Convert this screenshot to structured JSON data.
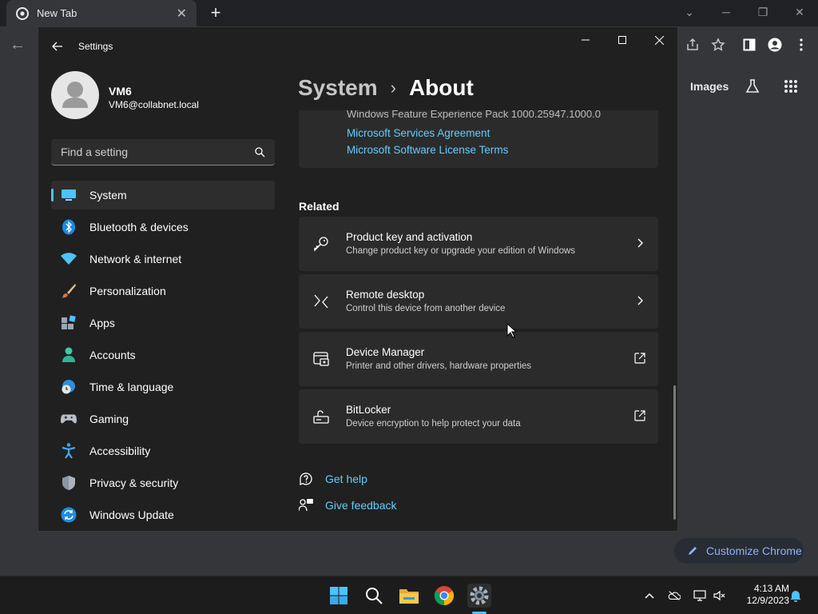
{
  "chrome": {
    "tab_title": "New Tab",
    "ntp_links": [
      "Images"
    ],
    "customize_label": "Customize Chrome"
  },
  "settings": {
    "window_title": "Settings",
    "profile": {
      "name": "VM6",
      "email": "VM6@collabnet.local"
    },
    "search": {
      "placeholder": "Find a setting"
    },
    "nav": [
      {
        "label": "System",
        "icon": "system-icon",
        "active": true
      },
      {
        "label": "Bluetooth & devices",
        "icon": "bluetooth-icon"
      },
      {
        "label": "Network & internet",
        "icon": "wifi-icon"
      },
      {
        "label": "Personalization",
        "icon": "brush-icon"
      },
      {
        "label": "Apps",
        "icon": "apps-icon"
      },
      {
        "label": "Accounts",
        "icon": "person-icon"
      },
      {
        "label": "Time & language",
        "icon": "globe-clock-icon"
      },
      {
        "label": "Gaming",
        "icon": "gamepad-icon"
      },
      {
        "label": "Accessibility",
        "icon": "accessibility-icon"
      },
      {
        "label": "Privacy & security",
        "icon": "shield-icon"
      },
      {
        "label": "Windows Update",
        "icon": "update-icon"
      }
    ],
    "breadcrumb": {
      "parent": "System",
      "separator": "›",
      "current": "About"
    },
    "specs": {
      "experience_pack": "Windows Feature Experience Pack 1000.25947.1000.0",
      "links": [
        "Microsoft Services Agreement",
        "Microsoft Software License Terms"
      ]
    },
    "related": {
      "heading": "Related",
      "items": [
        {
          "title": "Product key and activation",
          "desc": "Change product key or upgrade your edition of Windows",
          "icon": "key-icon",
          "action": "chevron-right-icon"
        },
        {
          "title": "Remote desktop",
          "desc": "Control this device from another device",
          "icon": "remote-desktop-icon",
          "action": "chevron-right-icon"
        },
        {
          "title": "Device Manager",
          "desc": "Printer and other drivers, hardware properties",
          "icon": "device-manager-icon",
          "action": "external-link-icon"
        },
        {
          "title": "BitLocker",
          "desc": "Device encryption to help protect your data",
          "icon": "bitlocker-icon",
          "action": "external-link-icon"
        }
      ]
    },
    "help": [
      {
        "label": "Get help",
        "icon": "help-icon"
      },
      {
        "label": "Give feedback",
        "icon": "feedback-icon"
      }
    ]
  },
  "taskbar": {
    "apps": [
      "start-icon",
      "search-icon",
      "file-explorer-icon",
      "chrome-icon",
      "settings-icon"
    ],
    "clock": {
      "time": "4:13 AM",
      "date": "12/9/2023"
    }
  },
  "colors": {
    "accent": "#60cdff",
    "window_bg": "#202020",
    "card_bg": "#2b2b2b",
    "selection": "#4cc2ff"
  }
}
